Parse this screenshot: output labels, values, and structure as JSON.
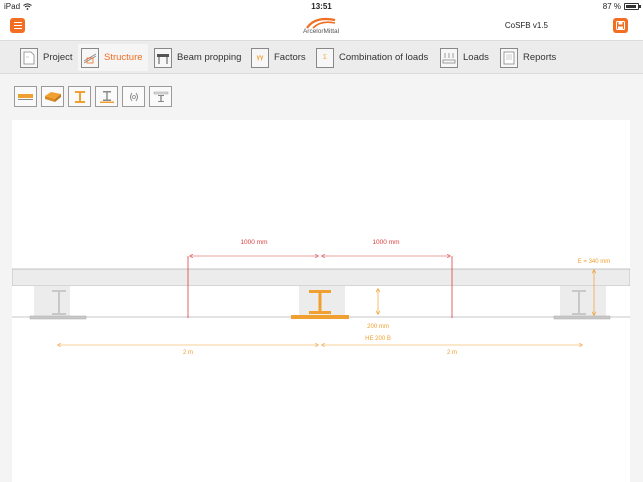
{
  "status_bar": {
    "device": "iPad",
    "time": "13:51",
    "battery": "87 %"
  },
  "header": {
    "brand": "ArcelorMittal",
    "app_title": "CoSFB v1.5"
  },
  "tabs": [
    {
      "label": "Project",
      "icon": "document-icon",
      "active": false
    },
    {
      "label": "Structure",
      "icon": "structure-icon",
      "active": true
    },
    {
      "label": "Beam propping",
      "icon": "propping-icon",
      "active": false
    },
    {
      "label": "Factors",
      "icon": "factors-icon",
      "active": false
    },
    {
      "label": "Combination of loads",
      "icon": "combination-icon",
      "active": false
    },
    {
      "label": "Loads",
      "icon": "loads-icon",
      "active": false
    },
    {
      "label": "Reports",
      "icon": "report-icon",
      "active": false
    }
  ],
  "toolbar": [
    {
      "name": "slab-section-tool",
      "icon": "slab-section-icon"
    },
    {
      "name": "slab-3d-tool",
      "icon": "slab-3d-icon"
    },
    {
      "name": "beam-section-tool",
      "icon": "i-beam-icon"
    },
    {
      "name": "beam-plate-tool",
      "icon": "i-beam-plate-icon"
    },
    {
      "name": "connector-tool",
      "icon": "connector-icon"
    },
    {
      "name": "composite-section-tool",
      "icon": "composite-section-icon"
    }
  ],
  "drawing": {
    "span_left_label": "1000 mm",
    "span_right_label": "1000 mm",
    "slab_thickness_label": "E = 340 mm",
    "beam_depth_label": "200 mm",
    "profile_label": "HE 200 B",
    "spacing_left_label": "2 m",
    "spacing_right_label": "2 m",
    "colors": {
      "accent": "#f26e22",
      "beam": "#f0a030",
      "dimension_red": "#d94040",
      "dimension_orange": "#f0a030",
      "slab_fill": "#ececec",
      "slab_stroke": "#b5b5b5"
    }
  }
}
